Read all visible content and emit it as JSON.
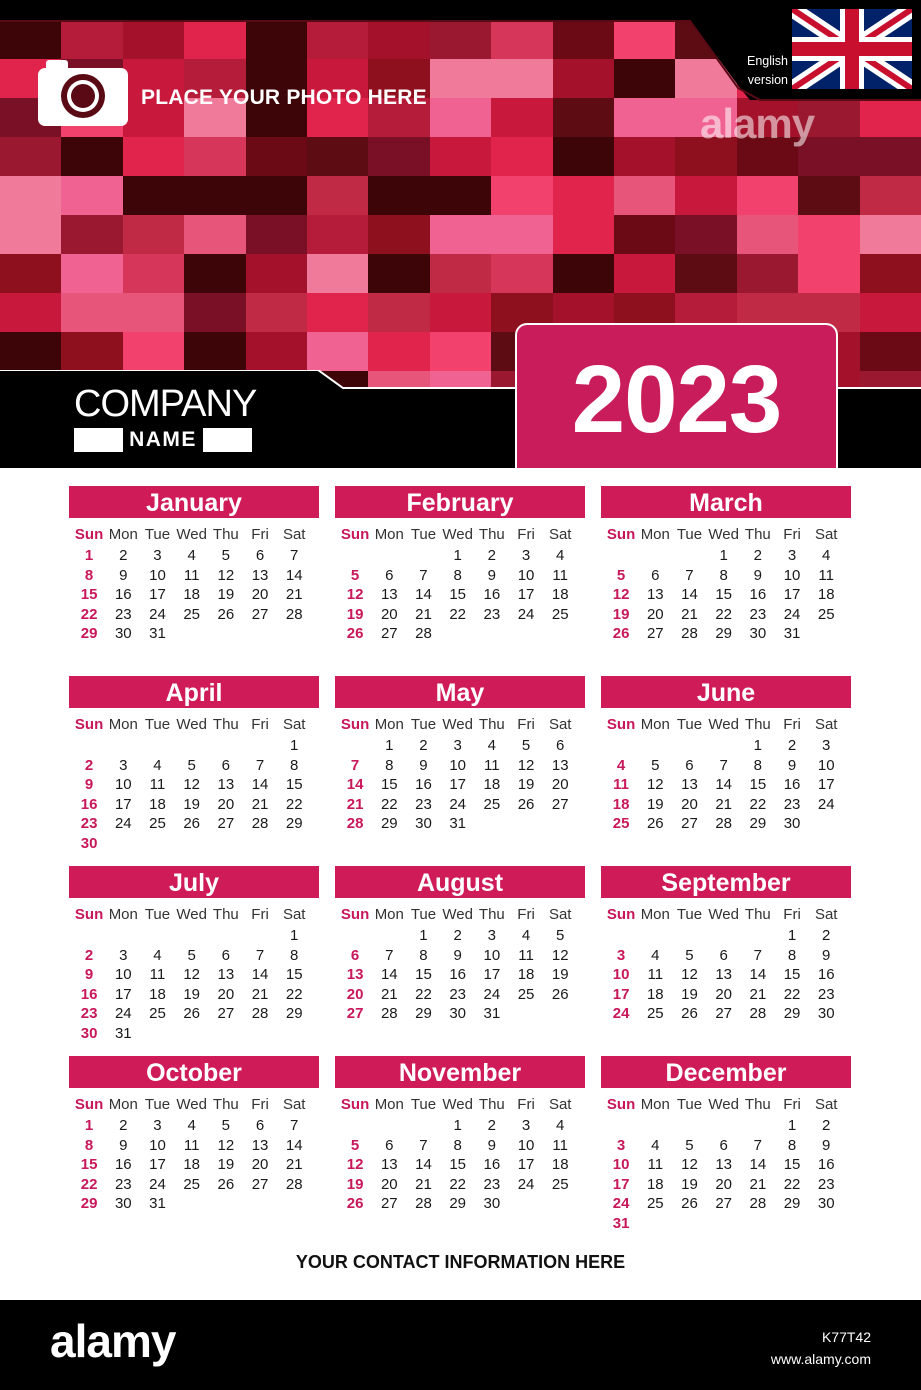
{
  "header": {
    "photo_placeholder": "PLACE YOUR PHOTO HERE",
    "language_label_line1": "English",
    "language_label_line2": "version",
    "company_line1": "COMPANY",
    "company_line2": "NAME",
    "year": "2023",
    "watermark": "alamy"
  },
  "weekdays": [
    "Sun",
    "Mon",
    "Tue",
    "Wed",
    "Thu",
    "Fri",
    "Sat"
  ],
  "months": [
    {
      "name": "January",
      "weeks": [
        [
          "1",
          "2",
          "3",
          "4",
          "5",
          "6",
          "7"
        ],
        [
          "8",
          "9",
          "10",
          "11",
          "12",
          "13",
          "14"
        ],
        [
          "15",
          "16",
          "17",
          "18",
          "19",
          "20",
          "21"
        ],
        [
          "22",
          "23",
          "24",
          "25",
          "26",
          "27",
          "28"
        ],
        [
          "29",
          "30",
          "31",
          "",
          "",
          "",
          ""
        ]
      ]
    },
    {
      "name": "February",
      "weeks": [
        [
          "",
          "",
          "",
          "1",
          "2",
          "3",
          "4"
        ],
        [
          "5",
          "6",
          "7",
          "8",
          "9",
          "10",
          "11"
        ],
        [
          "12",
          "13",
          "14",
          "15",
          "16",
          "17",
          "18"
        ],
        [
          "19",
          "20",
          "21",
          "22",
          "23",
          "24",
          "25"
        ],
        [
          "26",
          "27",
          "28",
          "",
          "",
          "",
          ""
        ]
      ]
    },
    {
      "name": "March",
      "weeks": [
        [
          "",
          "",
          "",
          "1",
          "2",
          "3",
          "4"
        ],
        [
          "5",
          "6",
          "7",
          "8",
          "9",
          "10",
          "11"
        ],
        [
          "12",
          "13",
          "14",
          "15",
          "16",
          "17",
          "18"
        ],
        [
          "19",
          "20",
          "21",
          "22",
          "23",
          "24",
          "25"
        ],
        [
          "26",
          "27",
          "28",
          "29",
          "30",
          "31",
          ""
        ]
      ]
    },
    {
      "name": "April",
      "weeks": [
        [
          "",
          "",
          "",
          "",
          "",
          "",
          "1"
        ],
        [
          "2",
          "3",
          "4",
          "5",
          "6",
          "7",
          "8"
        ],
        [
          "9",
          "10",
          "11",
          "12",
          "13",
          "14",
          "15"
        ],
        [
          "16",
          "17",
          "18",
          "19",
          "20",
          "21",
          "22"
        ],
        [
          "23",
          "24",
          "25",
          "26",
          "27",
          "28",
          "29"
        ],
        [
          "30",
          "",
          "",
          "",
          "",
          "",
          ""
        ]
      ]
    },
    {
      "name": "May",
      "weeks": [
        [
          "",
          "1",
          "2",
          "3",
          "4",
          "5",
          "6"
        ],
        [
          "7",
          "8",
          "9",
          "10",
          "11",
          "12",
          "13"
        ],
        [
          "14",
          "15",
          "16",
          "17",
          "18",
          "19",
          "20"
        ],
        [
          "21",
          "22",
          "23",
          "24",
          "25",
          "26",
          "27"
        ],
        [
          "28",
          "29",
          "30",
          "31",
          "",
          "",
          ""
        ]
      ]
    },
    {
      "name": "June",
      "weeks": [
        [
          "",
          "",
          "",
          "",
          "1",
          "2",
          "3"
        ],
        [
          "4",
          "5",
          "6",
          "7",
          "8",
          "9",
          "10"
        ],
        [
          "11",
          "12",
          "13",
          "14",
          "15",
          "16",
          "17"
        ],
        [
          "18",
          "19",
          "20",
          "21",
          "22",
          "23",
          "24"
        ],
        [
          "25",
          "26",
          "27",
          "28",
          "29",
          "30",
          ""
        ]
      ]
    },
    {
      "name": "July",
      "weeks": [
        [
          "",
          "",
          "",
          "",
          "",
          "",
          "1"
        ],
        [
          "2",
          "3",
          "4",
          "5",
          "6",
          "7",
          "8"
        ],
        [
          "9",
          "10",
          "11",
          "12",
          "13",
          "14",
          "15"
        ],
        [
          "16",
          "17",
          "18",
          "19",
          "20",
          "21",
          "22"
        ],
        [
          "23",
          "24",
          "25",
          "26",
          "27",
          "28",
          "29"
        ],
        [
          "30",
          "31",
          "",
          "",
          "",
          "",
          ""
        ]
      ]
    },
    {
      "name": "August",
      "weeks": [
        [
          "",
          "",
          "1",
          "2",
          "3",
          "4",
          "5"
        ],
        [
          "6",
          "7",
          "8",
          "9",
          "10",
          "11",
          "12"
        ],
        [
          "13",
          "14",
          "15",
          "16",
          "17",
          "18",
          "19"
        ],
        [
          "20",
          "21",
          "22",
          "23",
          "24",
          "25",
          "26"
        ],
        [
          "27",
          "28",
          "29",
          "30",
          "31",
          "",
          ""
        ]
      ]
    },
    {
      "name": "September",
      "weeks": [
        [
          "",
          "",
          "",
          "",
          "",
          "1",
          "2"
        ],
        [
          "3",
          "4",
          "5",
          "6",
          "7",
          "8",
          "9"
        ],
        [
          "10",
          "11",
          "12",
          "13",
          "14",
          "15",
          "16"
        ],
        [
          "17",
          "18",
          "19",
          "20",
          "21",
          "22",
          "23"
        ],
        [
          "24",
          "25",
          "26",
          "27",
          "28",
          "29",
          "30"
        ]
      ]
    },
    {
      "name": "October",
      "weeks": [
        [
          "1",
          "2",
          "3",
          "4",
          "5",
          "6",
          "7"
        ],
        [
          "8",
          "9",
          "10",
          "11",
          "12",
          "13",
          "14"
        ],
        [
          "15",
          "16",
          "17",
          "18",
          "19",
          "20",
          "21"
        ],
        [
          "22",
          "23",
          "24",
          "25",
          "26",
          "27",
          "28"
        ],
        [
          "29",
          "30",
          "31",
          "",
          "",
          "",
          ""
        ]
      ]
    },
    {
      "name": "November",
      "weeks": [
        [
          "",
          "",
          "",
          "1",
          "2",
          "3",
          "4"
        ],
        [
          "5",
          "6",
          "7",
          "8",
          "9",
          "10",
          "11"
        ],
        [
          "12",
          "13",
          "14",
          "15",
          "16",
          "17",
          "18"
        ],
        [
          "19",
          "20",
          "21",
          "22",
          "23",
          "24",
          "25"
        ],
        [
          "26",
          "27",
          "28",
          "29",
          "30",
          "",
          ""
        ]
      ]
    },
    {
      "name": "December",
      "weeks": [
        [
          "",
          "",
          "",
          "",
          "",
          "1",
          "2"
        ],
        [
          "3",
          "4",
          "5",
          "6",
          "7",
          "8",
          "9"
        ],
        [
          "10",
          "11",
          "12",
          "13",
          "14",
          "15",
          "16"
        ],
        [
          "17",
          "18",
          "19",
          "20",
          "21",
          "22",
          "23"
        ],
        [
          "24",
          "25",
          "26",
          "27",
          "28",
          "29",
          "30"
        ],
        [
          "31",
          "",
          "",
          "",
          "",
          "",
          ""
        ]
      ]
    }
  ],
  "contact": "YOUR CONTACT INFORMATION HERE",
  "footer": {
    "logo": "alamy",
    "image_id": "K77T42",
    "site": "www.alamy.com"
  },
  "colors": {
    "accent": "#cf1b58",
    "sunday": "#c8175a",
    "header_bg": "#1a0006"
  },
  "icons": [
    "camera-icon",
    "uk-flag-icon"
  ]
}
